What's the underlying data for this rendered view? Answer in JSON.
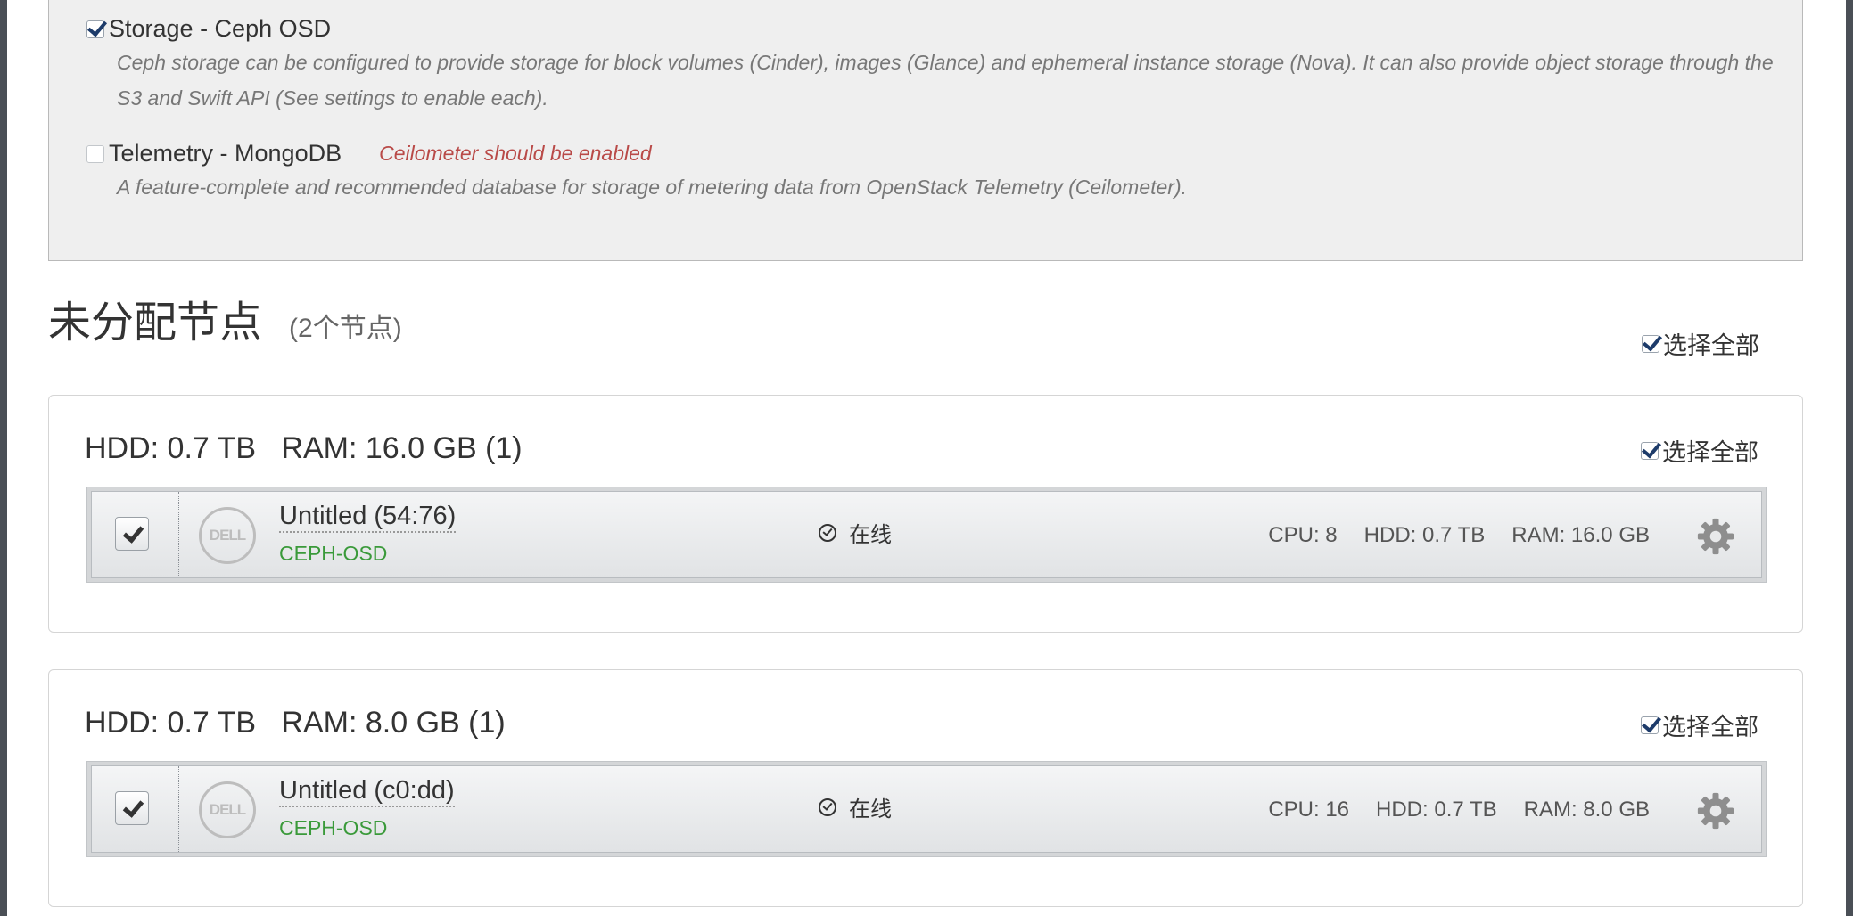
{
  "roles": [
    {
      "title": "Storage - Ceph OSD",
      "checked": true,
      "description": "Ceph storage can be configured to provide storage for block volumes (Cinder), images (Glance) and ephemeral instance storage (Nova). It can also provide object storage through the S3 and Swift API (See settings to enable each).",
      "warning": ""
    },
    {
      "title": "Telemetry - MongoDB",
      "checked": false,
      "description": "A feature-complete and recommended database for storage of metering data from OpenStack Telemetry (Ceilometer).",
      "warning": "Ceilometer should be enabled"
    }
  ],
  "section": {
    "title": "未分配节点",
    "count": "(2个节点)",
    "select_all_label": "选择全部"
  },
  "groups": [
    {
      "title": "HDD: 0.7 TB   RAM: 16.0 GB (1)",
      "select_all_label": "选择全部",
      "node": {
        "name": "Untitled (54:76)",
        "role": "CEPH-OSD",
        "status": "在线",
        "cpu": "CPU: 8",
        "hdd": "HDD: 0.7 TB",
        "ram": "RAM: 16.0 GB",
        "logo_text": "DELL",
        "checked": true
      }
    },
    {
      "title": "HDD: 0.7 TB   RAM: 8.0 GB (1)",
      "select_all_label": "选择全部",
      "node": {
        "name": "Untitled (c0:dd)",
        "role": "CEPH-OSD",
        "status": "在线",
        "cpu": "CPU: 16",
        "hdd": "HDD: 0.7 TB",
        "ram": "RAM: 8.0 GB",
        "logo_text": "DELL",
        "checked": true
      }
    }
  ],
  "icons": [
    "checkbox-icon",
    "checkmark-circle-icon",
    "gear-icon",
    "dell-logo-icon"
  ],
  "colors": {
    "warning": "#b94a48",
    "role_tag": "#3a9a3a",
    "panel_bg": "#efefef"
  }
}
